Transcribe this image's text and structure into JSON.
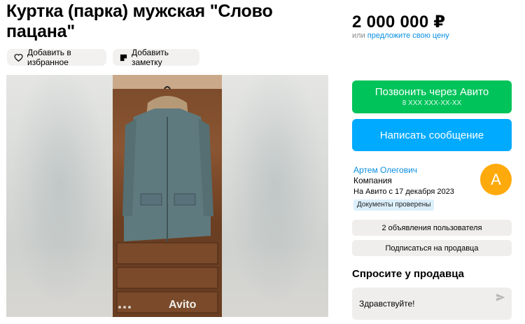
{
  "listing": {
    "title": "Куртка (парка) мужская \"Слово пацана\"",
    "actions": {
      "favorite_label": "Добавить в избранное",
      "note_label": "Добавить заметку"
    }
  },
  "gallery": {
    "watermark": "Avito"
  },
  "price": {
    "value": "2 000 000 ₽",
    "or_label": "или",
    "offer_link": "предложите свою цену"
  },
  "contact": {
    "call_label": "Позвонить через Авито",
    "phone_masked": "8 XXX XXX-XX-XX",
    "message_label": "Написать сообщение"
  },
  "seller": {
    "name": "Артем Олегович",
    "type": "Компания",
    "since": "На Авито с 17 декабря 2023",
    "verified_label": "Документы проверены",
    "avatar_letter": "А",
    "avatar_color": "#ffaa0c"
  },
  "seller_links": {
    "ads_label": "2 объявления пользователя",
    "subscribe_label": "Подписаться на продавца"
  },
  "ask": {
    "title": "Спросите у продавца",
    "input_value": "Здравствуйте!"
  },
  "colors": {
    "call_green": "#00c35a",
    "message_blue": "#00aaff",
    "link_blue": "#0a8ee0"
  }
}
